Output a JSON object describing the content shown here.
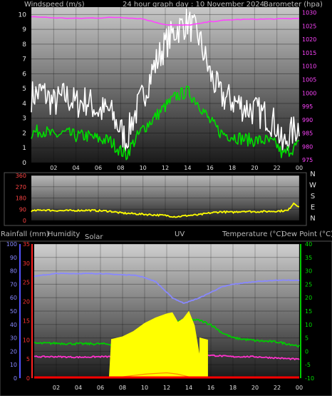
{
  "chart_data": [
    {
      "type": "line",
      "title": "24 hour graph day : 10 November 2024",
      "left_axis_label": "Windspeed (m/s)",
      "right_axis_label": "Barometer (hpa)",
      "x_ticks": [
        "02",
        "04",
        "06",
        "08",
        "10",
        "12",
        "14",
        "16",
        "18",
        "20",
        "22",
        "00"
      ],
      "y_left_ticks": [
        0,
        1,
        2,
        3,
        4,
        5,
        6,
        7,
        8,
        9,
        10
      ],
      "y_left_range": [
        0,
        10.5
      ],
      "y_right_ticks": [
        975,
        980,
        985,
        990,
        995,
        1000,
        1005,
        1010,
        1015,
        1020,
        1025,
        1030
      ],
      "y_right_range": [
        974,
        1032
      ],
      "series": [
        {
          "color": "#ffffff",
          "axis": "left",
          "x": [
            0,
            1,
            2,
            3,
            4,
            5,
            6,
            7,
            8,
            8.5,
            9,
            10,
            11,
            12,
            13,
            14,
            15,
            16,
            17,
            18,
            19,
            20,
            21,
            22,
            22.5,
            23,
            24
          ],
          "values": [
            4.5,
            4.8,
            4.0,
            4.5,
            4.0,
            4.2,
            3.5,
            3.5,
            2.2,
            1.5,
            2.8,
            4.5,
            6.5,
            8.0,
            9.0,
            9.5,
            8.5,
            6.0,
            4.5,
            4.2,
            3.8,
            3.5,
            3.2,
            2.5,
            1.0,
            1.8,
            2.5
          ]
        },
        {
          "color": "#00dd00",
          "axis": "left",
          "x": [
            0,
            1,
            2,
            3,
            4,
            5,
            6,
            7,
            8,
            8.5,
            9,
            10,
            11,
            12,
            13,
            14,
            15,
            16,
            17,
            18,
            19,
            20,
            21,
            22,
            22.5,
            23,
            24
          ],
          "values": [
            2.0,
            2.2,
            1.8,
            2.0,
            1.8,
            1.8,
            1.6,
            1.5,
            0.8,
            0.5,
            1.2,
            2.3,
            3.0,
            3.8,
            4.5,
            4.8,
            4.0,
            2.8,
            2.0,
            1.8,
            1.6,
            1.5,
            1.5,
            1.2,
            0.5,
            0.8,
            1.2
          ]
        },
        {
          "color": "#ff44ff",
          "axis": "right",
          "x": [
            0,
            2,
            4,
            6,
            8,
            10,
            11,
            12,
            13,
            14,
            15,
            16,
            18,
            20,
            22,
            24
          ],
          "values": [
            1028.5,
            1028,
            1027.8,
            1028,
            1028.2,
            1027.6,
            1026.5,
            1025.5,
            1025.3,
            1025.3,
            1025.8,
            1026.6,
            1027.3,
            1027.5,
            1027.6,
            1027.8
          ]
        }
      ]
    },
    {
      "type": "line",
      "axis_labels_right": [
        "N",
        "W",
        "S",
        "E",
        "N"
      ],
      "x_ticks": [
        "02",
        "04",
        "06",
        "08",
        "10",
        "12",
        "14",
        "16",
        "18",
        "20",
        "22",
        "00"
      ],
      "y_ticks": [
        0,
        90,
        180,
        270,
        360
      ],
      "y_range": [
        0,
        360
      ],
      "series": [
        {
          "color": "#ffff00",
          "x": [
            0,
            1,
            2,
            3,
            4,
            5,
            6,
            7,
            8,
            9,
            10,
            11,
            12,
            13,
            14,
            15,
            16,
            17,
            18,
            19,
            20,
            21,
            22,
            23,
            23.5,
            24
          ],
          "values": [
            75,
            85,
            80,
            78,
            80,
            82,
            78,
            75,
            60,
            55,
            50,
            45,
            40,
            30,
            40,
            45,
            60,
            70,
            65,
            75,
            70,
            72,
            75,
            80,
            140,
            110
          ]
        }
      ]
    },
    {
      "type": "line",
      "labels": {
        "rainfall": "Rainfall (mm)",
        "humidity": "Humidity",
        "solar": "Solar",
        "uv": "UV",
        "temperature": "Temperature (°C)",
        "dew_point": "Dew Point (°C)"
      },
      "x_ticks": [
        "02",
        "04",
        "06",
        "08",
        "10",
        "12",
        "14",
        "16",
        "18",
        "20",
        "22",
        "00"
      ],
      "humidity_ticks": [
        0,
        10,
        20,
        30,
        40,
        50,
        60,
        70,
        80,
        90,
        100
      ],
      "rain_ticks": [
        0,
        5,
        10,
        15,
        20,
        25,
        30,
        35
      ],
      "temp_ticks": [
        -10,
        -5,
        0,
        5,
        10,
        15,
        20,
        25,
        30,
        35,
        40
      ],
      "rain_range": [
        0,
        35
      ],
      "humidity_range": [
        0,
        100
      ],
      "temp_range": [
        -10,
        40
      ],
      "series": [
        {
          "name": "Humidity",
          "color": "#8888ff",
          "axis": "humidity",
          "x": [
            0,
            1,
            2,
            4,
            6,
            8,
            9,
            10,
            11,
            12,
            12.5,
            13,
            13.5,
            14,
            15,
            16,
            17,
            18,
            20,
            22,
            24
          ],
          "values": [
            76,
            77,
            78,
            78,
            78,
            77,
            77,
            75,
            72,
            64,
            60,
            58,
            56,
            57,
            60,
            64,
            68,
            70,
            72,
            73,
            73
          ]
        },
        {
          "name": "Temperature",
          "color": "#00cc00",
          "axis": "temp",
          "x": [
            0,
            2,
            4,
            6,
            8,
            9,
            10,
            11,
            12,
            13,
            14,
            15,
            16,
            17,
            18,
            20,
            22,
            24
          ],
          "values": [
            3,
            3,
            2.8,
            2.8,
            2.5,
            3,
            5,
            7,
            9,
            11,
            12,
            11.5,
            10,
            7,
            5,
            4,
            3.5,
            2
          ]
        },
        {
          "name": "Dew Point",
          "color": "#ff33cc",
          "axis": "temp",
          "x": [
            0,
            2,
            4,
            6,
            8,
            10,
            12,
            13,
            14,
            16,
            18,
            20,
            22,
            24
          ],
          "values": [
            -2,
            -2,
            -2.2,
            -2,
            -2,
            -1.5,
            -0.5,
            -0.2,
            -0.5,
            -1.5,
            -2,
            -2,
            -2.5,
            -3
          ]
        },
        {
          "name": "Solar",
          "color": "#ffff00",
          "type": "area",
          "axis": "humidity",
          "x": [
            6.8,
            7,
            8,
            9,
            10,
            11,
            12,
            12.5,
            13,
            13.5,
            14,
            14.5,
            15,
            15,
            15.7,
            15.7
          ],
          "values": [
            0,
            30,
            28,
            36,
            40,
            42,
            46,
            48,
            44,
            46,
            47,
            40,
            18,
            30,
            30,
            0
          ]
        },
        {
          "name": "UV",
          "color": "#ff8800",
          "axis": "humidity",
          "x": [
            8,
            9,
            10,
            11,
            12,
            12.5,
            13,
            13.5,
            14
          ],
          "values": [
            1,
            2,
            3,
            3.5,
            4,
            3.5,
            3,
            2,
            1
          ]
        },
        {
          "name": "Rainfall",
          "color": "#ff0000",
          "axis": "rain",
          "x": [
            0,
            24
          ],
          "values": [
            0,
            0
          ]
        }
      ]
    }
  ]
}
